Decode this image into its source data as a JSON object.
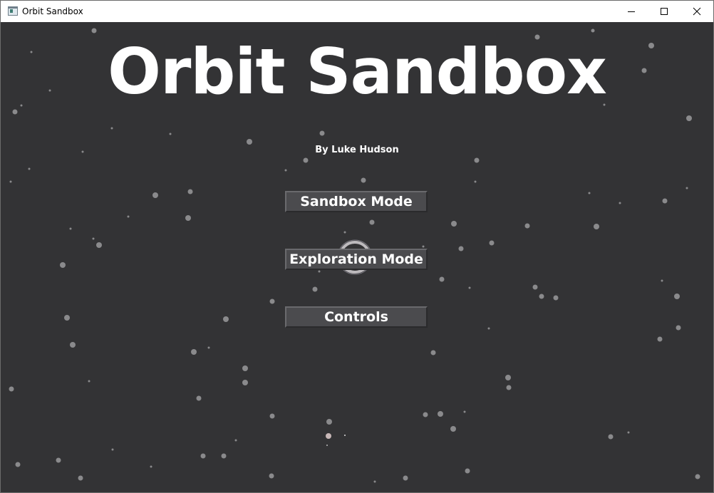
{
  "window": {
    "title": "Orbit Sandbox",
    "controls": {
      "minimize": "minimize",
      "maximize": "maximize",
      "close": "close"
    }
  },
  "menu": {
    "title": "Orbit Sandbox",
    "author": "By Luke Hudson",
    "buttons": [
      {
        "label": "Sandbox Mode"
      },
      {
        "label": "Exploration Mode"
      },
      {
        "label": "Controls"
      }
    ]
  },
  "colors": {
    "background": "#333335",
    "star": "#8a8a8c",
    "button_face": "#4b4b4e",
    "text": "#ffffff"
  }
}
